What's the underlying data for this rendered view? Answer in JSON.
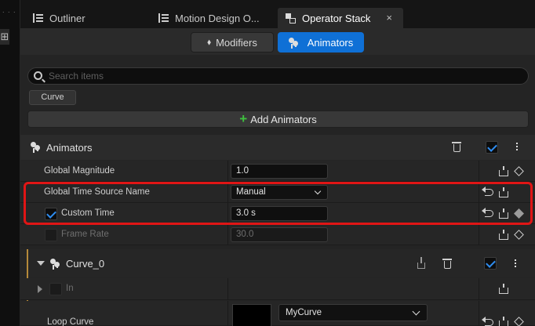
{
  "tabs": [
    {
      "label": "Outliner",
      "icon": "outliner-icon",
      "active": false
    },
    {
      "label": "Motion Design O...",
      "icon": "outliner-icon",
      "active": false
    },
    {
      "label": "Operator Stack",
      "icon": "operator-stack-icon",
      "active": true,
      "close": "×"
    }
  ],
  "modes": {
    "modifiers_label": "Modifiers",
    "animators_label": "Animators",
    "active": "Animators"
  },
  "search": {
    "placeholder": "Search items",
    "value": ""
  },
  "filter_chip": "Curve",
  "add_animators_label": "Add Animators",
  "animators_section": {
    "title": "Animators",
    "enabled": true
  },
  "properties": {
    "global_magnitude": {
      "label": "Global Magnitude",
      "value": "1.0"
    },
    "global_time_source": {
      "label": "Global Time Source Name",
      "value": "Manual"
    },
    "custom_time": {
      "label": "Custom Time",
      "value": "3.0 s",
      "checked": true
    },
    "frame_rate": {
      "label": "Frame Rate",
      "value": "30.0",
      "checked": false
    }
  },
  "curve_section": {
    "title": "Curve_0",
    "enabled": true,
    "in_label": "In",
    "loop_curve_label": "Loop Curve",
    "curve_asset": "MyCurve"
  },
  "colors": {
    "accent": "#0f70d6",
    "highlight_box": "#e01515",
    "add_plus": "#3fc13f",
    "curve_stripe": "#b68a3a"
  }
}
